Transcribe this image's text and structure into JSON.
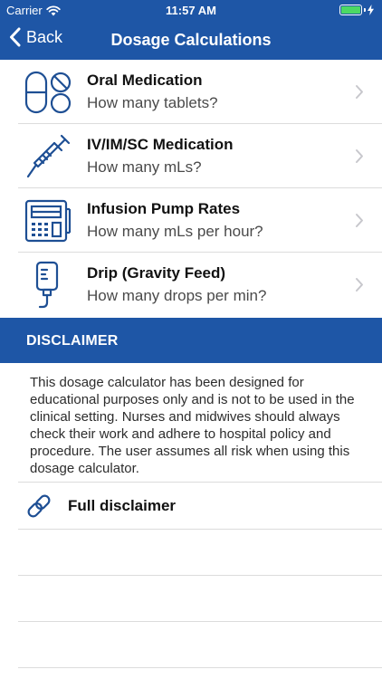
{
  "status_bar": {
    "carrier": "Carrier",
    "time": "11:57 AM"
  },
  "nav": {
    "back_label": "Back",
    "title": "Dosage Calculations"
  },
  "menu": {
    "items": [
      {
        "title": "Oral Medication",
        "subtitle": "How many tablets?",
        "icon": "pills-icon"
      },
      {
        "title": "IV/IM/SC Medication",
        "subtitle": "How many mLs?",
        "icon": "syringe-icon"
      },
      {
        "title": "Infusion Pump Rates",
        "subtitle": "How many mLs per hour?",
        "icon": "infusion-pump-icon"
      },
      {
        "title": "Drip (Gravity Feed)",
        "subtitle": "How many drops per min?",
        "icon": "iv-drip-bag-icon"
      }
    ]
  },
  "disclaimer": {
    "heading": "DISCLAIMER",
    "text": "This dosage calculator has been designed for educational purposes only and is not to be used in the clinical setting. Nurses and midwives should always check their work and adhere to hospital policy and procedure. The user assumes all risk when using this dosage calculator.",
    "full_link_label": "Full disclaimer"
  },
  "colors": {
    "brand_blue": "#1e56a6",
    "icon_blue": "#1e4f94",
    "battery_green": "#4cd964"
  }
}
